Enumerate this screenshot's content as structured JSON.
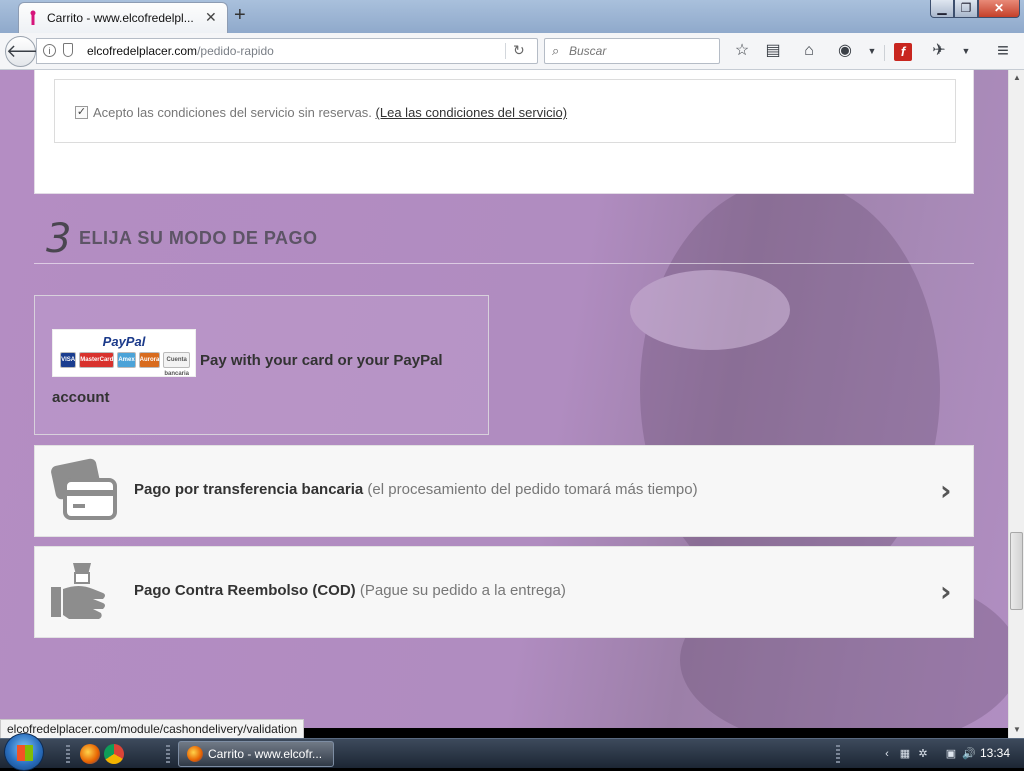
{
  "browser": {
    "tab_title": "Carrito - www.elcofredelpl...",
    "tab_close": "✕",
    "new_tab": "+",
    "url_host": "elcofredelplacer.com",
    "url_path": "/pedido-rapido",
    "search_placeholder": "Buscar",
    "status_url": "elcofredelplacer.com/module/cashondelivery/validation"
  },
  "terms": {
    "label": "Acepto las condiciones del servicio sin reservas.",
    "link": "(Lea las condiciones del servicio)",
    "checked": true
  },
  "payment": {
    "step_number": "3",
    "step_title": "ELIJA SU MODO DE PAGO",
    "paypal": {
      "logo_text": "PayPal",
      "cards": [
        "VISA",
        "MasterCard",
        "Amex",
        "Aurora",
        "Cuenta bancaria"
      ],
      "text": "Pay with your card or your PayPal account"
    },
    "options": [
      {
        "label": "Pago por transferencia bancaria",
        "note": "(el procesamiento del pedido tomará más tiempo)",
        "icon": "credit-card-icon"
      },
      {
        "label": "Pago Contra Reembolso (COD)",
        "note": "(Pague su pedido a la entrega)",
        "icon": "cash-hand-icon"
      }
    ]
  },
  "taskbar": {
    "task_label": "Carrito - www.elcofr...",
    "clock": "13:34"
  },
  "colors": {
    "page_bg": "#b48dc3",
    "option_bg": "#f7f7f7",
    "flash": "#c8261f"
  }
}
